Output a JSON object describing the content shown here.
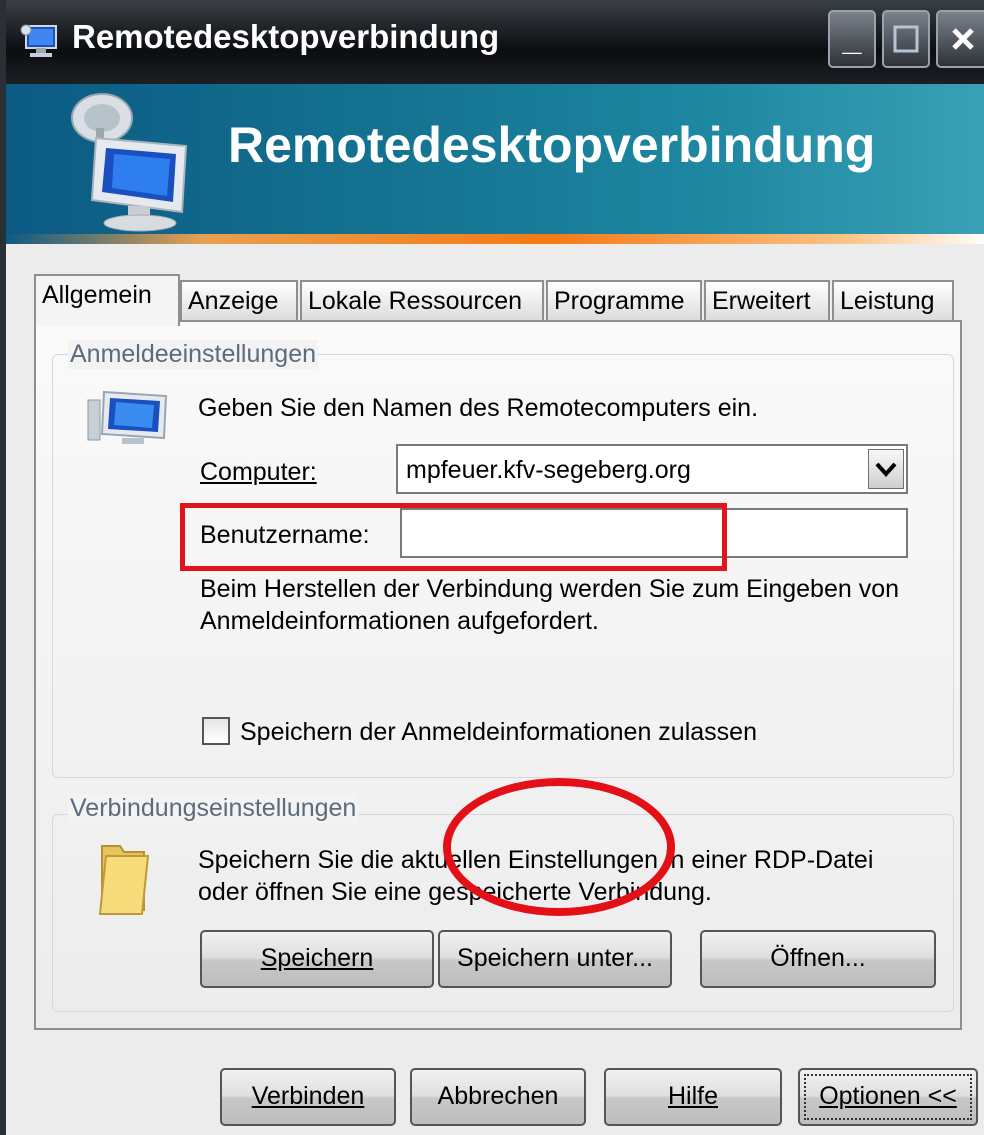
{
  "window": {
    "title": "Remotedesktopverbindung",
    "controls": {
      "minimize": "_",
      "maximize": "□",
      "close": "✕"
    }
  },
  "banner": {
    "title": "Remotedesktopverbindung"
  },
  "tabs": [
    {
      "label": "Allgemein",
      "active": true
    },
    {
      "label": "Anzeige"
    },
    {
      "label": "Lokale Ressourcen"
    },
    {
      "label": "Programme"
    },
    {
      "label": "Erweitert"
    },
    {
      "label": "Leistung"
    }
  ],
  "login_settings": {
    "group_label": "Anmeldeeinstellungen",
    "instruction": "Geben Sie den Namen des Remotecomputers ein.",
    "computer_label": "Computer:",
    "computer_value": "mpfeuer.kfv-segeberg.org",
    "username_label": "Benutzername:",
    "username_value": "",
    "info_line1": "Beim Herstellen der Verbindung werden Sie zum Eingeben von",
    "info_line2": "Anmeldeinformationen aufgefordert.",
    "save_credentials_label": "Speichern der Anmeldeinformationen zulassen",
    "save_credentials_checked": false
  },
  "connection_settings": {
    "group_label": "Verbindungseinstellungen",
    "text_line1": "Speichern Sie die aktuellen Einstellungen in einer RDP-Datei",
    "text_line2": "oder öffnen Sie eine gespeicherte Verbindung.",
    "save_button": "Speichern",
    "save_as_button": "Speichern unter...",
    "open_button": "Öffnen..."
  },
  "footer": {
    "connect_button": "Verbinden",
    "cancel_button": "Abbrechen",
    "help_button": "Hilfe",
    "options_button": "Optionen <<"
  },
  "colors": {
    "highlight_red": "#e31017",
    "banner_blue": "#13708f",
    "banner_orange": "#f47a14"
  }
}
